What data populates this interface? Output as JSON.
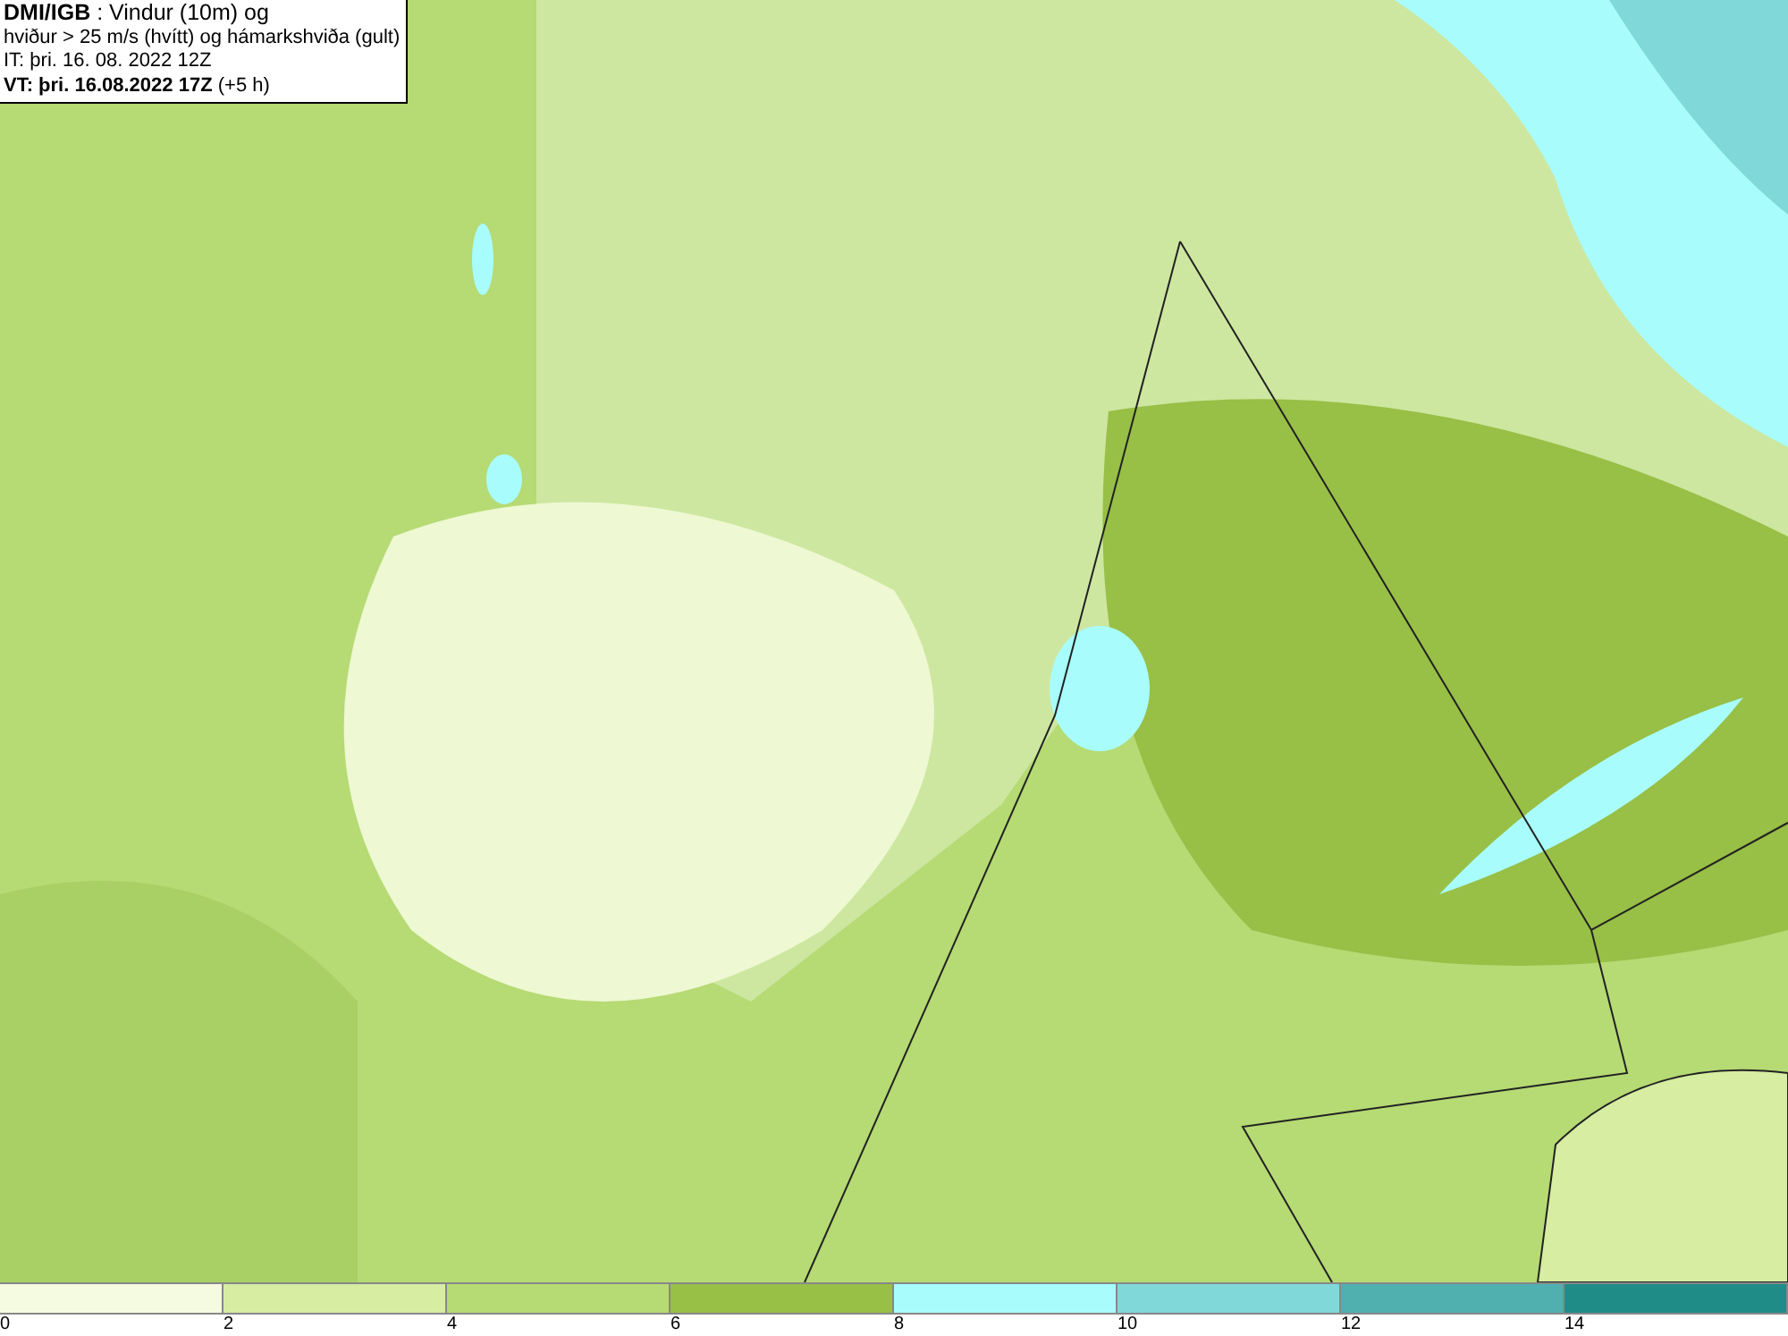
{
  "info": {
    "lines": [
      "**DMI/IGB** : Vindur (10m) og",
      "hviður > 25 m/s (hvítt) og hámarkshviða (gult)",
      "IT: þri. 16. 08. 2022 12Z",
      "**VT: þri. 16.08.2022 17Z** (+5 h)"
    ]
  },
  "legend": {
    "bins": [
      {
        "color": "#f5fbe1",
        "label": "0"
      },
      {
        "color": "#d6eda2",
        "label": "2"
      },
      {
        "color": "#b6da74",
        "label": "4"
      },
      {
        "color": "#98bf46",
        "label": "6"
      },
      {
        "color": "#a8fcfc",
        "label": "8"
      },
      {
        "color": "#80d8d8",
        "label": "10"
      },
      {
        "color": "#50b0b0",
        "label": "12"
      },
      {
        "color": "#208c88",
        "label": "14"
      }
    ]
  }
}
